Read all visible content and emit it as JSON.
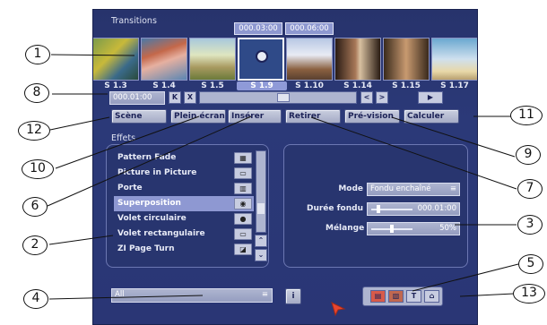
{
  "section_titles": {
    "transitions": "Transitions",
    "effects": "Effets"
  },
  "timecodes": {
    "left": "000.03:00",
    "right": "000.06:00"
  },
  "scenes": [
    "S 1.3",
    "S 1.4",
    "S 1.5",
    "S 1.9",
    "S 1.10",
    "S 1.14",
    "S 1.15",
    "S 1.17"
  ],
  "selected_scene": "S 1.9",
  "position_field": "000.01:00",
  "transport": {
    "rewind": "K",
    "stop": "X",
    "prev": "<",
    "next": ">",
    "play": "▶"
  },
  "buttons": {
    "scene": "Scène",
    "fullscreen": "Plein écran",
    "insert": "Insérer",
    "remove": "Retirer",
    "preview": "Pré-vision",
    "calculate": "Calculer"
  },
  "effects": [
    {
      "label": "Pattern Fade",
      "icon": "pattern-icon"
    },
    {
      "label": "Picture in Picture",
      "icon": "pip-icon"
    },
    {
      "label": "Porte",
      "icon": "door-icon"
    },
    {
      "label": "Superposition",
      "icon": "overlay-icon"
    },
    {
      "label": "Volet circulaire",
      "icon": "circle-wipe-icon"
    },
    {
      "label": "Volet rectangulaire",
      "icon": "rect-wipe-icon"
    },
    {
      "label": "ZI Page Turn",
      "icon": "page-turn-icon"
    }
  ],
  "selected_effect": "Superposition",
  "settings": {
    "mode_label": "Mode",
    "mode_value": "Fondu enchaîné",
    "duration_label": "Durée fondu",
    "duration_value": "000.01:00",
    "mix_label": "Mélange",
    "mix_value": "50%",
    "mix_fraction": 0.5
  },
  "filter_value": "All",
  "info_button": "i",
  "toolbar_icons": [
    "film-icon",
    "photo-icon",
    "text-icon",
    "home-icon"
  ],
  "toolbar_text": "T",
  "callouts": [
    "1",
    "2",
    "3",
    "4",
    "5",
    "6",
    "7",
    "8",
    "9",
    "10",
    "11",
    "12",
    "13"
  ],
  "colors": {
    "background": "#2a3675",
    "selected": "#8e98d2",
    "cursor": "#e8452e"
  }
}
